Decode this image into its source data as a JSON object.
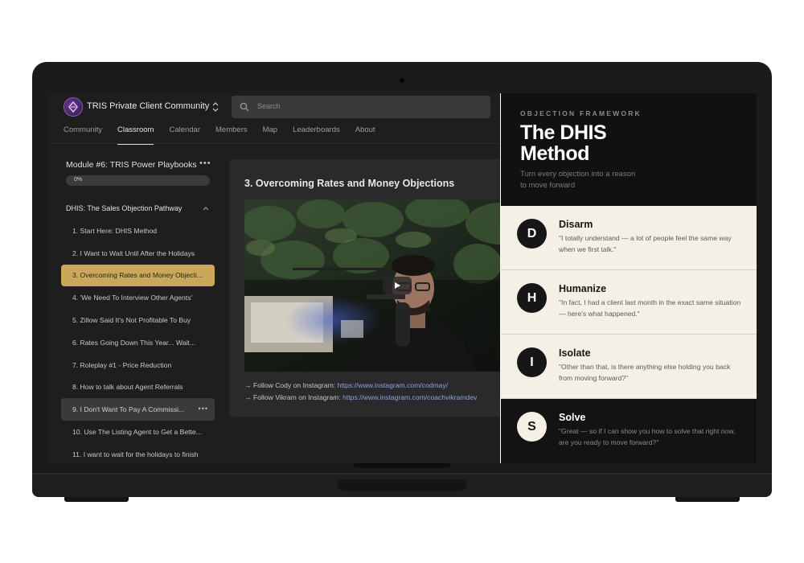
{
  "app": {
    "community_name": "TRIS Private Client Community",
    "search_placeholder": "Search"
  },
  "nav": {
    "tabs": [
      {
        "label": "Community",
        "active": false
      },
      {
        "label": "Classroom",
        "active": true
      },
      {
        "label": "Calendar",
        "active": false
      },
      {
        "label": "Members",
        "active": false
      },
      {
        "label": "Map",
        "active": false
      },
      {
        "label": "Leaderboards",
        "active": false
      },
      {
        "label": "About",
        "active": false
      }
    ]
  },
  "sidebar": {
    "module_title": "Module #6: TRIS Power Playbooks",
    "progress_label": "0%",
    "progress": 0,
    "section_title": "DHIS: The Sales Objection Pathway",
    "lessons": [
      {
        "label": "1. Start Here: DHIS Method",
        "state": "normal"
      },
      {
        "label": "2. I Want to Wait Until After the Holidays",
        "state": "normal"
      },
      {
        "label": "3. Overcoming Rates and Money Objecti...",
        "state": "active"
      },
      {
        "label": "4. 'We Need To Interview Other Agents'",
        "state": "normal"
      },
      {
        "label": "5. Zillow Said It's Not Profitable To Buy",
        "state": "normal"
      },
      {
        "label": "6. Rates Going Down This Year... Wait...",
        "state": "normal"
      },
      {
        "label": "7. Roleplay #1 - Price Reduction",
        "state": "normal"
      },
      {
        "label": "8. How to talk about Agent Referrals",
        "state": "normal"
      },
      {
        "label": "9. I Don't Want To Pay A Commissi...",
        "state": "hover"
      },
      {
        "label": "10. Use The Listing Agent to Get a Bette...",
        "state": "normal"
      },
      {
        "label": "11. I want to wait for the holidays to finish",
        "state": "normal"
      }
    ]
  },
  "content": {
    "lesson_heading": "3. Overcoming Rates and Money Objections",
    "link1_prefix": "→ Follow Cody on Instagram: ",
    "link1_url": "https://www.instagram.com/codmay/",
    "link2_prefix": "→ Follow Vikram on Instagram: ",
    "link2_url": "https://www.instagram.com/coachvikramdev"
  },
  "panel": {
    "kicker": "OBJECTION FRAMEWORK",
    "title": "The DHIS Method",
    "subtitle": "Turn every objection into a reason to move forward",
    "steps": [
      {
        "letter": "D",
        "name": "Disarm",
        "quote": "\"I totally understand — a lot of people feel the same way when we first talk.\""
      },
      {
        "letter": "H",
        "name": "Humanize",
        "quote": "\"In fact, I had a client last month in the exact same situation — here's what happened.\""
      },
      {
        "letter": "I",
        "name": "Isolate",
        "quote": "\"Other than that, is there anything else holding you back from moving forward?\""
      },
      {
        "letter": "S",
        "name": "Solve",
        "quote": "\"Great — so if I can show you how to solve that right now, are you ready to move forward?\""
      }
    ]
  },
  "colors": {
    "accent_gold": "#c9a85c",
    "panel_cream": "#f5f0e6",
    "link_blue": "#8aa4d8"
  }
}
